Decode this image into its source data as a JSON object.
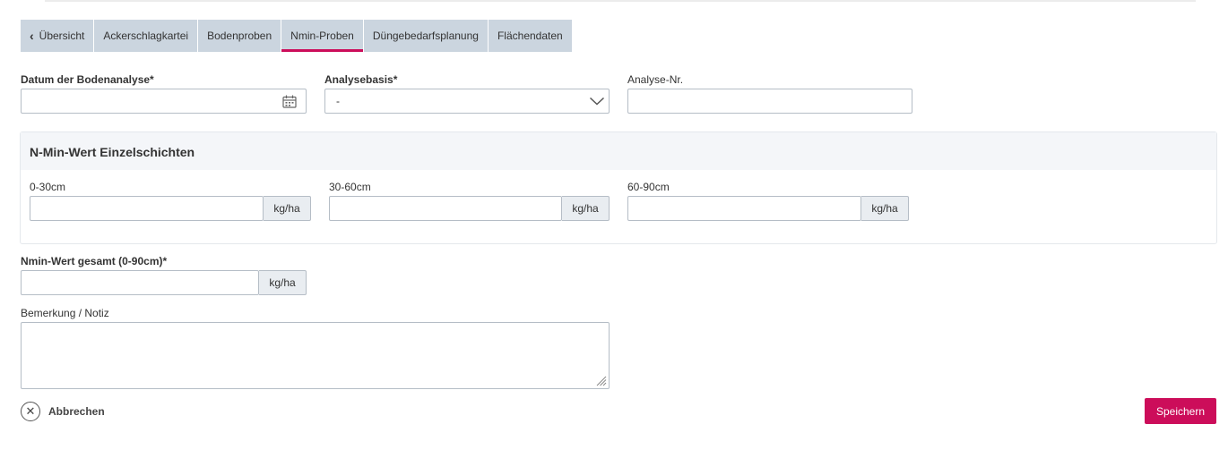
{
  "tabs": [
    {
      "label": "Übersicht",
      "has_back_icon": true
    },
    {
      "label": "Ackerschlagkartei"
    },
    {
      "label": "Bodenproben"
    },
    {
      "label": "Nmin-Proben",
      "active": true
    },
    {
      "label": "Düngebedarfsplanung"
    },
    {
      "label": "Flächendaten"
    }
  ],
  "form": {
    "date_label": "Datum der Bodenanalyse*",
    "date_value": "",
    "basis_label": "Analysebasis*",
    "basis_value": "-",
    "analysis_nr_label": "Analyse-Nr.",
    "analysis_nr_value": ""
  },
  "layers_panel": {
    "title": "N-Min-Wert Einzelschichten",
    "fields": [
      {
        "label": "0-30cm",
        "unit": "kg/ha",
        "value": ""
      },
      {
        "label": "30-60cm",
        "unit": "kg/ha",
        "value": ""
      },
      {
        "label": "60-90cm",
        "unit": "kg/ha",
        "value": ""
      }
    ]
  },
  "total": {
    "label": "Nmin-Wert gesamt (0-90cm)*",
    "unit": "kg/ha",
    "value": ""
  },
  "note": {
    "label": "Bemerkung / Notiz",
    "value": ""
  },
  "actions": {
    "cancel_label": "Abbrechen",
    "save_label": "Speichern"
  },
  "colors": {
    "accent": "#cc0d5a",
    "tab_bg": "#cbd5df",
    "addon_bg": "#e9edf1",
    "panel_head_bg": "#f4f6f9"
  },
  "icons": {
    "back": "chevron-left-icon",
    "date": "calendar-icon",
    "select": "chevron-down-icon",
    "cancel": "close-circle-icon",
    "textarea": "resize-grip-icon"
  }
}
